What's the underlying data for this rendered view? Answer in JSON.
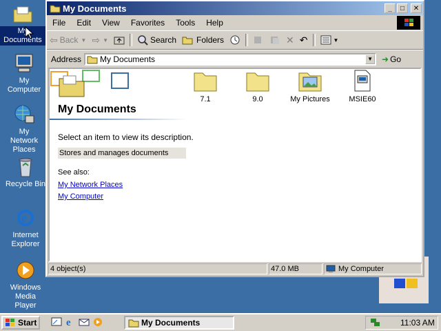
{
  "desktop": {
    "icons": [
      {
        "label": "My Documents"
      },
      {
        "label": "My Computer"
      },
      {
        "label": "My Network Places"
      },
      {
        "label": "Recycle Bin"
      },
      {
        "label": "Internet Explorer"
      },
      {
        "label": "Windows Media Player"
      }
    ]
  },
  "window": {
    "title": "My Documents",
    "buttons": {
      "minimize": "_",
      "maximize": "□",
      "close": "✕"
    },
    "menu": [
      "File",
      "Edit",
      "View",
      "Favorites",
      "Tools",
      "Help"
    ],
    "toolbar": {
      "back": "Back",
      "search": "Search",
      "folders": "Folders"
    },
    "address": {
      "label": "Address",
      "value": "My Documents",
      "go": "Go"
    },
    "pane": {
      "heading": "My Documents",
      "description": "Select an item to view its description.",
      "info": "Stores and manages documents",
      "see_also": "See also:",
      "links": [
        "My Network Places",
        "My Computer"
      ]
    },
    "items": [
      {
        "label": "7.1",
        "icon": "folder-icon"
      },
      {
        "label": "9.0",
        "icon": "folder-icon"
      },
      {
        "label": "My Pictures",
        "icon": "pictures-folder-icon"
      },
      {
        "label": "MSIE60",
        "icon": "setup-file-icon"
      }
    ],
    "status": {
      "objects": "4 object(s)",
      "size": "47.0 MB",
      "location": "My Computer"
    }
  },
  "taskbar": {
    "start": "Start",
    "task": "My Documents",
    "clock": "11:03 AM"
  },
  "colors": {
    "desktop": "#3a6ea5",
    "titlebar": "#0a246a",
    "chrome": "#d4d0c8"
  }
}
